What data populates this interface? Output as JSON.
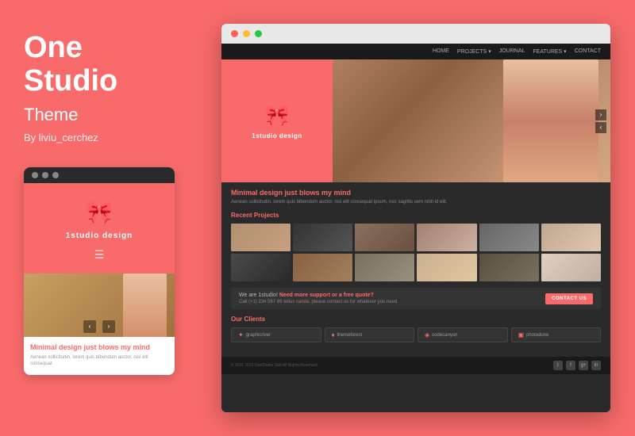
{
  "left": {
    "title_line1": "One",
    "title_line2": "Studio",
    "subtitle": "Theme",
    "author": "By liviu_cerchez",
    "mobile": {
      "logo_text": "1studio design",
      "heading": "Minimal design ",
      "heading_highlight": "just blows my mind",
      "body_text": "Aenean sollicitudin, lorem quis bibendum auctor, nisi elit consequat"
    }
  },
  "browser": {
    "nav": {
      "items": [
        "HOME",
        "PROJECTS ▾",
        "JOURNAL",
        "FEATURES ▾",
        "CONTACT"
      ]
    },
    "hero": {
      "logo_text": "1studio design"
    },
    "tagline": "Minimal design ",
    "tagline_highlight": "just blows my mind",
    "desc": "Aenean sollicitudin, lorem quis bibendum auctor, nisi elit consequat ipsum, nec sagittis sem nibh id elit.",
    "recent_projects_label": "Recent Projects",
    "cta": {
      "text": "We are 1studio! ",
      "highlight": "Need more support or a free quote?",
      "phone": "Call (+1) 234 567 89 tellus canda, please contact us for whatever you need.",
      "button": "CONTACT US"
    },
    "clients_label": "Our Clients",
    "clients": [
      "graphicriver",
      "themeforest",
      "codecanyon",
      "photodune"
    ],
    "footer": {
      "copy": "© 2011 2012 OneStudio Sarl All Rights Reserved.",
      "social": [
        "t",
        "f",
        "g+",
        "in"
      ]
    }
  },
  "colors": {
    "accent": "#f96b6b",
    "dark_bg": "#2a2a2a",
    "darker_bg": "#1a1a1a"
  }
}
